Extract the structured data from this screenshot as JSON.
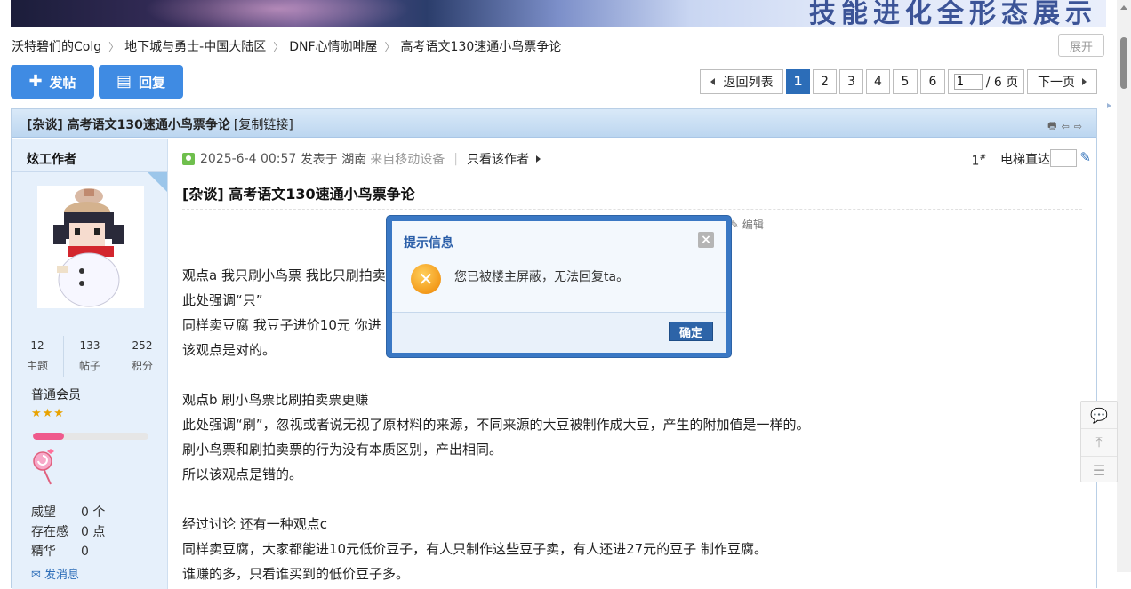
{
  "breadcrumb": {
    "items": [
      "沃特碧们的Colg",
      "地下城与勇士-中国大陆区",
      "DNF心情咖啡屋",
      "高考语文130速通小鸟票争论"
    ]
  },
  "expand_label": "展开",
  "actions": {
    "post_label": "发帖",
    "reply_label": "回复"
  },
  "pager": {
    "back_label": "返回列表",
    "pages": [
      "1",
      "2",
      "3",
      "4",
      "5",
      "6"
    ],
    "current_page": "1",
    "jump_value": "1",
    "total_label": "/ 6 页",
    "next_label": "下一页"
  },
  "thread": {
    "title": "[杂谈] 高考语文130速通小鸟票争论",
    "copy_link": "[复制链接]"
  },
  "author": {
    "name": "炫工作者",
    "stats": [
      {
        "value": "12",
        "label": "主题"
      },
      {
        "value": "133",
        "label": "帖子"
      },
      {
        "value": "252",
        "label": "积分"
      }
    ],
    "group": "普通会员",
    "stars": "★★★",
    "progress_fraction": 0.27,
    "meta": [
      {
        "key": "威望",
        "value": "0 个"
      },
      {
        "key": "存在感",
        "value": "0 点"
      },
      {
        "key": "精华",
        "value": "0"
      }
    ],
    "send_msg": "发消息"
  },
  "post": {
    "date": "2025-6-4 00:57",
    "posted_in": "发表于 湖南",
    "device": "来自移动设备",
    "only_author": "只看该作者",
    "floor": "1",
    "elevator": "电梯直达",
    "title": "[杂谈] 高考语文130速通小鸟票争论",
    "edit": "编辑",
    "body": [
      "观点a 我只刷小鸟票 我比只刷拍卖",
      "此处强调“只”",
      "同样卖豆腐 我豆子进价10元 你进",
      "该观点是对的。",
      "",
      "观点b 刷小鸟票比刷拍卖票更赚",
      "此处强调“刷”，忽视或者说无视了原材料的来源，不同来源的大豆被制作成大豆，产生的附加值是一样的。",
      "刷小鸟票和刷拍卖票的行为没有本质区别，产出相同。",
      "所以该观点是错的。",
      "",
      "经过讨论 还有一种观点c",
      "同样卖豆腐，大家都能进10元低价豆子，有人只制作这些豆子卖，有人还进27元的豆子 制作豆腐。",
      "谁赚的多，只看谁买到的低价豆子多。"
    ]
  },
  "dialog": {
    "title": "提示信息",
    "message": "您已被楼主屏蔽，无法回复ta。",
    "ok_label": "确定"
  },
  "colors": {
    "accent": "#3f8be3",
    "header_blue": "#2c6db8",
    "dialog_border": "#3a78c4",
    "side_bg": "#e6f0fb",
    "progress_pink": "#ef5a8c"
  }
}
